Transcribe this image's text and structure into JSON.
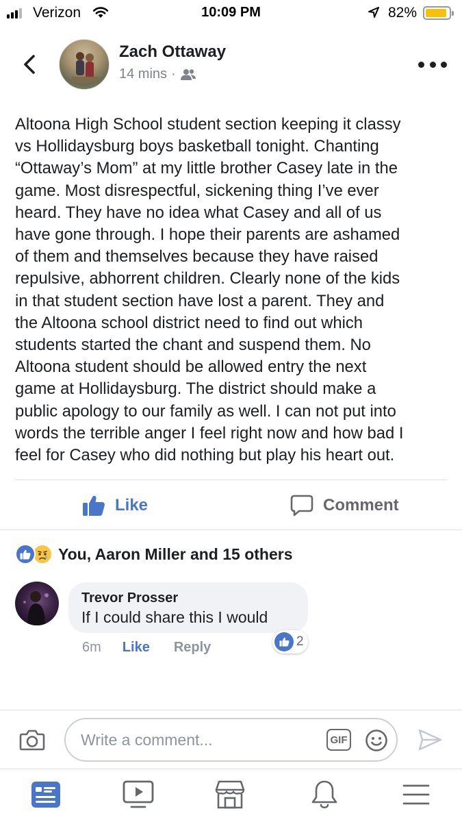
{
  "status_bar": {
    "carrier": "Verizon",
    "time": "10:09 PM",
    "battery_percent": "82%",
    "battery_level": 0.82,
    "signal_bars": 3
  },
  "post": {
    "author": "Zach Ottaway",
    "timestamp": "14 mins",
    "separator": "·",
    "audience_icon": "friends-icon",
    "body": "Altoona High School student section keeping it classy\nvs Hollidaysburg boys basketball tonight. Chanting\n“Ottaway’s Mom” at my little brother Casey late in the\ngame. Most disrespectful, sickening thing I’ve ever\nheard. They have no idea what Casey and all of us\nhave gone through. I hope their parents are ashamed\nof them and themselves because they have raised\nrepulsive, abhorrent children. Clearly none of the kids\nin that student section have lost a parent. They and\nthe Altoona school district need to find out which\nstudents started the chant and suspend them. No\nAltoona student should be allowed entry the next\ngame at Hollidaysburg. The district should make a\npublic apology to our family as well. I can not put into\nwords the terrible anger I feel right now and how bad I\nfeel for Casey who did nothing but play his heart out.",
    "actions": {
      "like_label": "Like",
      "comment_label": "Comment"
    },
    "reactions_summary": "You, Aaron Miller and 15 others",
    "reaction_icons": [
      "like-icon",
      "sad-icon"
    ]
  },
  "comments": [
    {
      "author": "Trevor Prosser",
      "text": "If I could share this I would",
      "time": "6m",
      "like_label": "Like",
      "reply_label": "Reply",
      "reaction_count": "2"
    }
  ],
  "composer": {
    "placeholder": "Write a comment...",
    "gif_label": "GIF"
  },
  "colors": {
    "accent": "#4a76c9",
    "muted": "#8d949e",
    "bubble": "#f0f2f5",
    "battery": "#f6c10a"
  },
  "tabbar": {
    "items": [
      "news-feed-icon",
      "watch-icon",
      "marketplace-icon",
      "notifications-icon",
      "menu-icon"
    ],
    "active": "news-feed-icon"
  }
}
